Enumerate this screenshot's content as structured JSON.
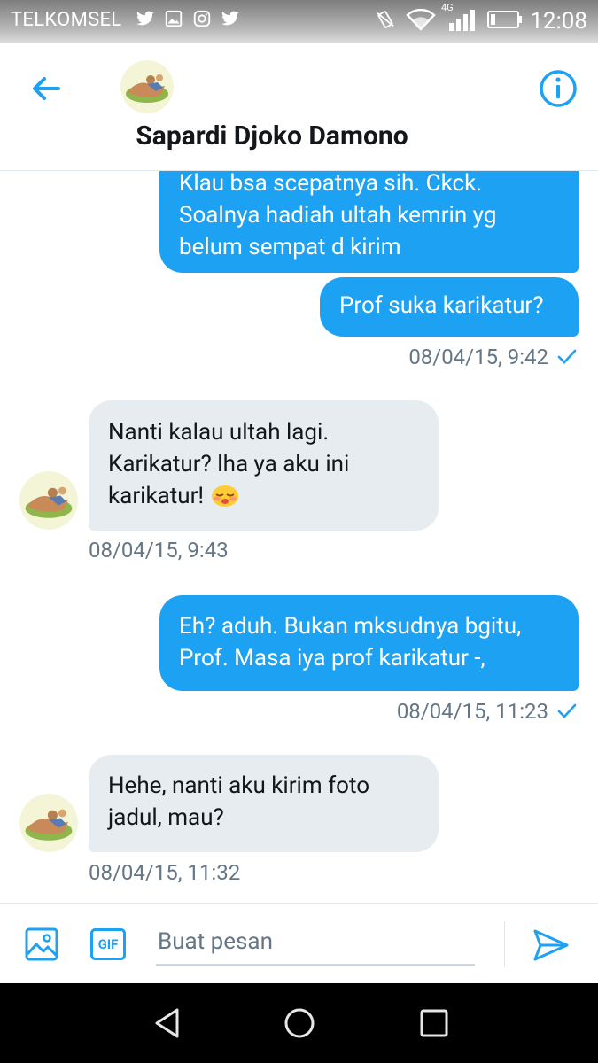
{
  "status_bar": {
    "carrier": "TELKOMSEL",
    "network": "4G",
    "time": "12:08"
  },
  "header": {
    "contact_name": "Sapardi Djoko Damono",
    "back_icon": "arrow-left-icon",
    "info_icon": "info-icon"
  },
  "messages": [
    {
      "direction": "out",
      "lines": [
        "Klau bsa scepatnya sih. Ckck.",
        "Soalnya hadiah ultah kemrin yg",
        "belum sempat d kirim"
      ]
    },
    {
      "direction": "out",
      "lines": [
        "Prof suka karikatur?"
      ],
      "timestamp": "08/04/15, 9:42",
      "read": true
    },
    {
      "direction": "in",
      "lines": [
        "Nanti kalau ultah lagi.",
        "Karikatur? lha ya aku ini",
        "karikatur!"
      ],
      "emoji": "sleepy-face-emoji",
      "timestamp": "08/04/15, 9:43"
    },
    {
      "direction": "out",
      "lines": [
        "Eh? aduh. Bukan mksudnya bgitu,",
        "Prof. Masa iya prof karikatur -,"
      ],
      "timestamp": "08/04/15, 11:23",
      "read": true
    },
    {
      "direction": "in",
      "lines": [
        "Hehe, nanti aku kirim foto",
        "jadul, mau?"
      ],
      "timestamp": "08/04/15, 11:32"
    }
  ],
  "composer": {
    "placeholder": "Buat pesan",
    "gif_label": "GIF"
  },
  "colors": {
    "accent": "#1da1f2",
    "incoming_bubble": "#e6ecf0",
    "meta_text": "#657786"
  }
}
